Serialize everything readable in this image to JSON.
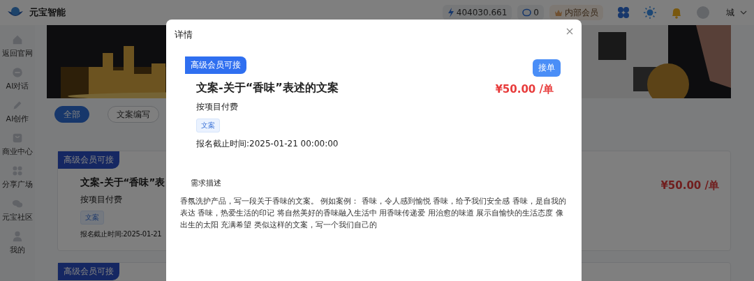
{
  "header": {
    "app_name": "元宝智能",
    "balance": "404030.661",
    "messages": "0",
    "membership": "内部会员",
    "user": "城"
  },
  "sidebar": {
    "items": [
      {
        "label": "返回官网",
        "kind": "home"
      },
      {
        "label": "AI对话",
        "kind": "chat"
      },
      {
        "label": "AI创作",
        "kind": "pencil"
      },
      {
        "label": "商业中心",
        "kind": "bag"
      },
      {
        "label": "分享广场",
        "kind": "grid"
      },
      {
        "label": "元宝社区",
        "kind": "chats"
      },
      {
        "label": "我的",
        "kind": "person"
      }
    ]
  },
  "filters": [
    {
      "label": "全部",
      "selected": true
    },
    {
      "label": "文案编写",
      "selected": false
    }
  ],
  "cards": [
    {
      "badge": "高级会员可接",
      "title": "文案-关于“香味”表",
      "payment": "按项目付费",
      "tags": [
        "文案"
      ],
      "deadline": "报名截止时间:2025-01-21",
      "price": "¥50.00 /单"
    },
    {
      "badge": "高级会员可接"
    }
  ],
  "dialog": {
    "title": "详情",
    "badge": "高级会员可接",
    "action": "接单",
    "task_title": "文案-关于“香味”表述的文案",
    "price": "¥50.00 /单",
    "payment": "按项目付费",
    "tags": [
      "文案"
    ],
    "deadline": "报名截止时间:2025-01-21 00:00:00",
    "description_label": "需求描述",
    "description": "香氛洗护产品，写一段关于香味的文案。 例如案例： 香味，令人感到愉悦 香味，给予我们安全感 香味，是自我的表达 香味，热爱生活的印记 将自然美好的香味融入生活中 用香味传递爱 用治愈的味道 展示自愉快的生活态度 像出生的太阳 充满希望 类似这样的文案，写一个我们自己的"
  }
}
